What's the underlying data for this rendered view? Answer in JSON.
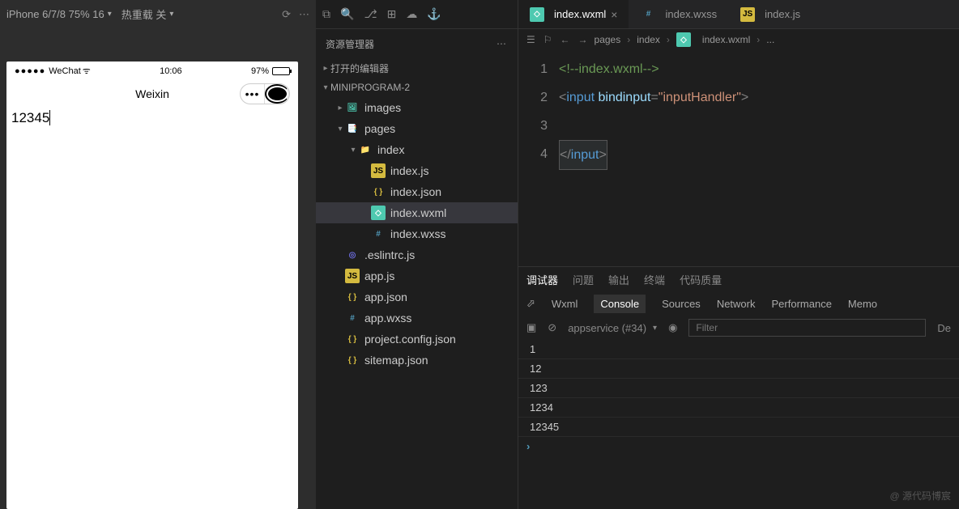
{
  "sim": {
    "device": "iPhone 6/7/8 75% 16",
    "hot_reload": "热重载 关",
    "carrier": "WeChat",
    "time": "10:06",
    "battery_pct": "97%",
    "title": "Weixin",
    "input_value": "12345"
  },
  "sidebar": {
    "title": "资源管理器",
    "sections": {
      "open_editors": "打开的编辑器",
      "project": "MINIPROGRAM-2"
    },
    "tree": [
      {
        "name": "images",
        "kind": "folder-img",
        "indent": 1,
        "chev": "closed"
      },
      {
        "name": "pages",
        "kind": "folder-pages",
        "indent": 1,
        "chev": "open"
      },
      {
        "name": "index",
        "kind": "folder",
        "indent": 2,
        "chev": "open"
      },
      {
        "name": "index.js",
        "kind": "js",
        "indent": 3,
        "chev": "none"
      },
      {
        "name": "index.json",
        "kind": "json",
        "indent": 3,
        "chev": "none"
      },
      {
        "name": "index.wxml",
        "kind": "wxml",
        "indent": 3,
        "chev": "none",
        "selected": true
      },
      {
        "name": "index.wxss",
        "kind": "wxss",
        "indent": 3,
        "chev": "none"
      },
      {
        "name": ".eslintrc.js",
        "kind": "eslint",
        "indent": 1,
        "chev": "none"
      },
      {
        "name": "app.js",
        "kind": "js",
        "indent": 1,
        "chev": "none"
      },
      {
        "name": "app.json",
        "kind": "json",
        "indent": 1,
        "chev": "none"
      },
      {
        "name": "app.wxss",
        "kind": "wxss",
        "indent": 1,
        "chev": "none"
      },
      {
        "name": "project.config.json",
        "kind": "json",
        "indent": 1,
        "chev": "none"
      },
      {
        "name": "sitemap.json",
        "kind": "json",
        "indent": 1,
        "chev": "none"
      }
    ]
  },
  "tabs": [
    {
      "label": "index.wxml",
      "icon": "wxml",
      "active": true
    },
    {
      "label": "index.wxss",
      "icon": "wxss",
      "active": false
    },
    {
      "label": "index.js",
      "icon": "js",
      "active": false
    }
  ],
  "breadcrumb": [
    "pages",
    "index",
    "index.wxml",
    "..."
  ],
  "code": {
    "lines": [
      "1",
      "2",
      "3",
      "4"
    ],
    "l1_comment": "<!--index.wxml-->",
    "l2_tag": "input",
    "l2_attr": "bindinput",
    "l2_val": "\"inputHandler\"",
    "l4_tag": "input"
  },
  "panel": {
    "tabs": [
      "调试器",
      "问题",
      "输出",
      "终端",
      "代码质量"
    ],
    "active_tab": "调试器",
    "devtools_tabs": [
      "Wxml",
      "Console",
      "Sources",
      "Network",
      "Performance",
      "Memo"
    ],
    "active_devtools": "Console",
    "context": "appservice (#34)",
    "filter_placeholder": "Filter",
    "default_levels": "De",
    "console_lines": [
      "1",
      "12",
      "123",
      "1234",
      "12345"
    ]
  },
  "watermark": "@ 源代码博宸"
}
